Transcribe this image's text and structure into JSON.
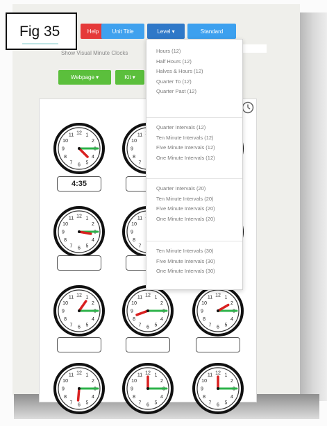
{
  "figure": {
    "label": "Fig 35"
  },
  "toolbar": {
    "red_label": "Help",
    "blue1_label": "Unit Title",
    "dark_label": "Level",
    "blue2_label": "Standard"
  },
  "options": {
    "text": "Show Visual  Minute Clocks"
  },
  "actions": {
    "webpage_label": "Webpage",
    "kit_label": "Kit"
  },
  "dropdown": {
    "groups": [
      [
        "Hours (12)",
        "Half Hours (12)",
        "Halves & Hours (12)",
        "Quarter To (12)",
        "Quarter Past (12)"
      ],
      [
        "Quarter Intervals (12)",
        "Ten Minute Intervals (12)",
        "Five Minute Intervals (12)",
        "One Minute Intervals (12)"
      ],
      [
        "Quarter Intervals (20)",
        "Ten Minute Intervals (20)",
        "Five Minute Intervals (20)",
        "One Minute Intervals (20)"
      ],
      [
        "Ten Minute Intervals (30)",
        "Five Minute Intervals (30)",
        "One Minute Intervals (30)"
      ]
    ]
  },
  "worksheet": {
    "answers": [
      "4:35",
      "",
      "",
      "",
      "",
      "",
      "",
      "",
      "",
      "",
      "",
      ""
    ]
  },
  "colors": {
    "minute_hand": "#2db34a",
    "hour_hand": "#d92020",
    "clock_rim": "#111111",
    "green_button": "#5bbf3c"
  }
}
